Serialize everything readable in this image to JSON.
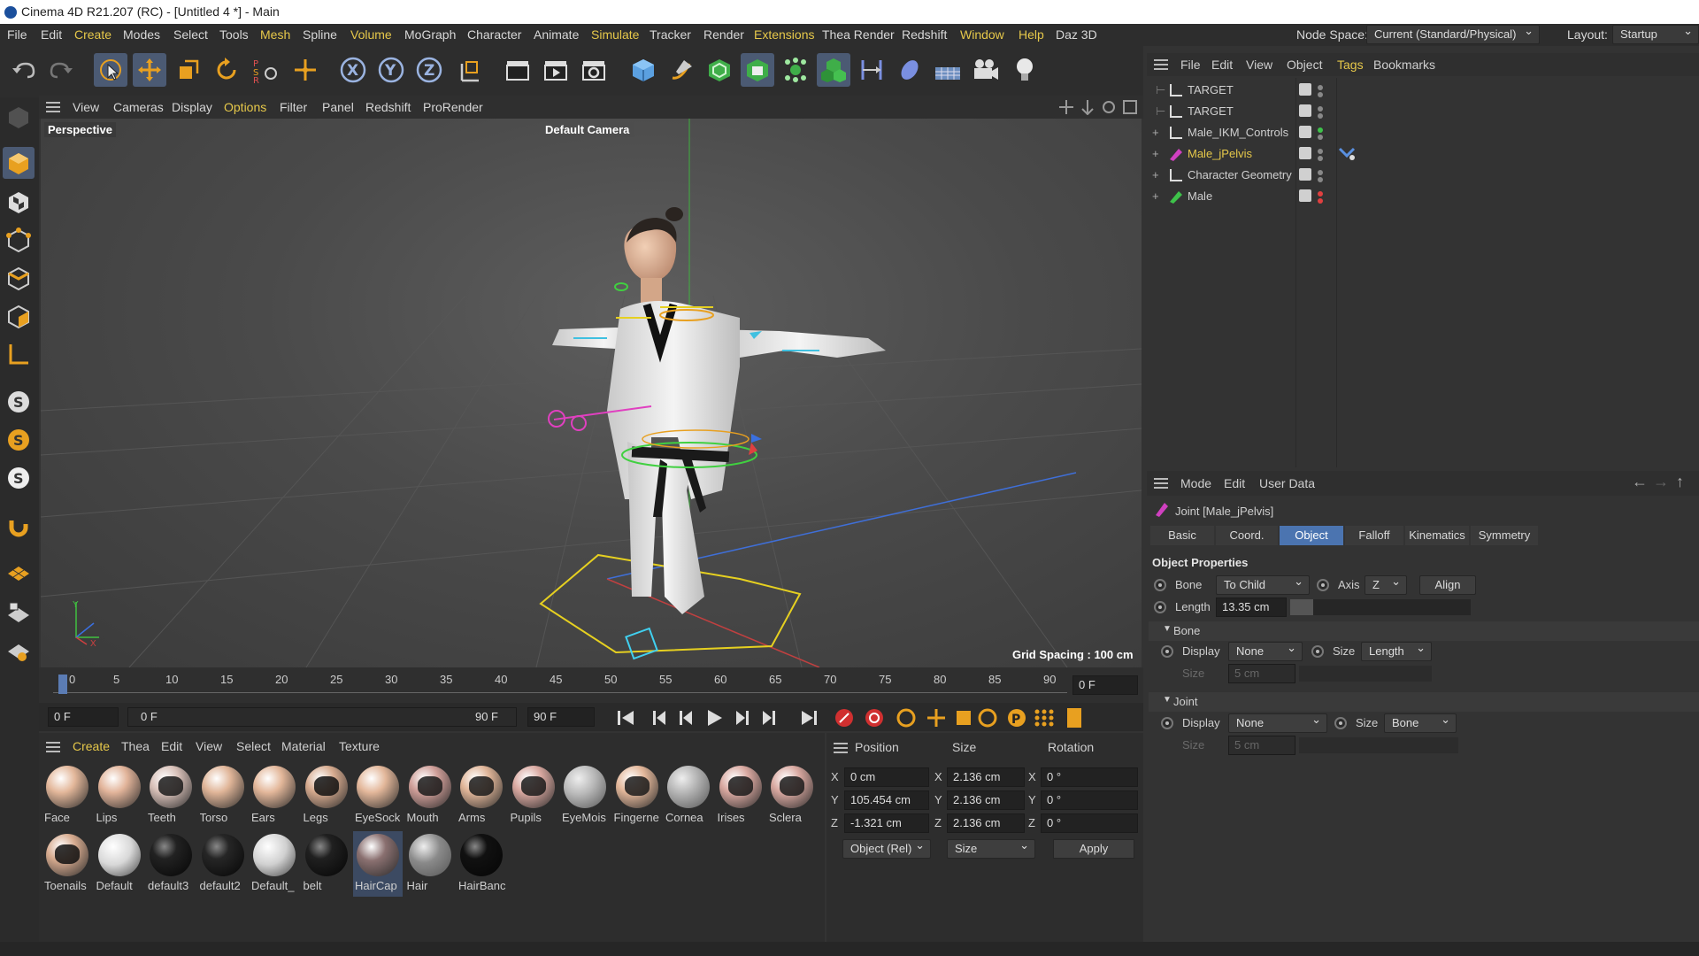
{
  "window": {
    "title": "Cinema 4D R21.207 (RC) - [Untitled 4 *] - Main"
  },
  "menubar": {
    "items": [
      "File",
      "Edit",
      "Create",
      "Modes",
      "Select",
      "Tools",
      "Mesh",
      "Spline",
      "Volume",
      "MoGraph",
      "Character",
      "Animate",
      "Simulate",
      "Tracker",
      "Render",
      "Extensions",
      "Thea Render",
      "Redshift",
      "Window",
      "Help",
      "Daz 3D"
    ],
    "node_space_label": "Node Space:",
    "node_space_value": "Current (Standard/Physical)",
    "layout_label": "Layout:",
    "layout_value": "Startup"
  },
  "viewport": {
    "menu": [
      "View",
      "Cameras",
      "Display",
      "Options",
      "Filter",
      "Panel",
      "Redshift",
      "ProRender"
    ],
    "label": "Perspective",
    "camera": "Default Camera",
    "grid_spacing": "Grid Spacing : 100 cm",
    "axis_y": "Y",
    "axis_x": "X"
  },
  "timeline": {
    "ticks": [
      "0",
      "5",
      "10",
      "15",
      "20",
      "25",
      "30",
      "35",
      "40",
      "45",
      "50",
      "55",
      "60",
      "65",
      "70",
      "75",
      "80",
      "85",
      "90"
    ],
    "current_frame": "0 F"
  },
  "transport": {
    "start": "0 F",
    "range_start": "0 F",
    "range_end": "90 F",
    "end": "90 F"
  },
  "material_panel": {
    "menu": [
      "Create",
      "Thea",
      "Edit",
      "View",
      "Select",
      "Material",
      "Texture"
    ],
    "materials": [
      {
        "name": "Face",
        "color": "#e3b79a",
        "style": "skin"
      },
      {
        "name": "Lips",
        "color": "#e2b49a",
        "style": "skin"
      },
      {
        "name": "Teeth",
        "color": "#d8c0b8",
        "style": "teeth"
      },
      {
        "name": "Torso",
        "color": "#e0b598",
        "style": "skin"
      },
      {
        "name": "Ears",
        "color": "#e3b79a",
        "style": "skin"
      },
      {
        "name": "Legs",
        "color": "#d7ab8f",
        "style": "legs"
      },
      {
        "name": "EyeSock",
        "color": "#e3b79a",
        "style": "skin"
      },
      {
        "name": "Mouth",
        "color": "#cf9e98",
        "style": "teeth"
      },
      {
        "name": "Arms",
        "color": "#e0b598",
        "style": "arms"
      },
      {
        "name": "Pupils",
        "color": "#d9a8a0",
        "style": "pupils"
      },
      {
        "name": "EyeMois",
        "color": "#b8b8b8",
        "style": "glass"
      },
      {
        "name": "Fingerne",
        "color": "#e3b79a",
        "style": "arms"
      },
      {
        "name": "Cornea",
        "color": "#b0b0b0",
        "style": "glass"
      },
      {
        "name": "Irises",
        "color": "#d9a8a0",
        "style": "pupils"
      },
      {
        "name": "Sclera",
        "color": "#d9a8a0",
        "style": "pupils"
      },
      {
        "name": "Toenails",
        "color": "#d7ab8f",
        "style": "legs"
      },
      {
        "name": "Default",
        "color": "#d8d8d8",
        "style": "white"
      },
      {
        "name": "default3",
        "color": "#222222",
        "style": "dark"
      },
      {
        "name": "default2",
        "color": "#262626",
        "style": "dark"
      },
      {
        "name": "Default_",
        "color": "#d0d0d0",
        "style": "white"
      },
      {
        "name": "belt",
        "color": "#202020",
        "style": "dark"
      },
      {
        "name": "HairCap",
        "color": "#8a7070",
        "style": "haircap"
      },
      {
        "name": "Hair",
        "color": "#8a8a8a",
        "style": "glass"
      },
      {
        "name": "HairBanc",
        "color": "#111111",
        "style": "black"
      }
    ],
    "selected": "HairCap"
  },
  "coord_panel": {
    "headers": [
      "Position",
      "Size",
      "Rotation"
    ],
    "rows": [
      {
        "axis": "X",
        "pos": "0 cm",
        "size": "2.136 cm",
        "rot": "0 °"
      },
      {
        "axis": "Y",
        "pos": "105.454 cm",
        "size": "2.136 cm",
        "rot": "0 °"
      },
      {
        "axis": "Z",
        "pos": "-1.321 cm",
        "size": "2.136 cm",
        "rot": "0 °"
      }
    ],
    "mode": "Object (Rel)",
    "size_mode": "Size",
    "apply": "Apply"
  },
  "object_manager": {
    "menu": [
      "File",
      "Edit",
      "View",
      "Object",
      "Tags",
      "Bookmarks"
    ],
    "objects": [
      {
        "name": "TARGET",
        "expand": "",
        "dot": "#888888"
      },
      {
        "name": "TARGET",
        "expand": "",
        "dot": "#888888"
      },
      {
        "name": "Male_IKM_Controls",
        "expand": "+",
        "dot": "#3ec24a"
      },
      {
        "name": "Male_jPelvis",
        "expand": "+",
        "dot": "#888888"
      },
      {
        "name": "Character Geometry",
        "expand": "+",
        "dot": "#888888"
      },
      {
        "name": "Male",
        "expand": "+",
        "dot": "#e04040"
      }
    ],
    "selected": "Male_jPelvis"
  },
  "attributes": {
    "menu": [
      "Mode",
      "Edit",
      "User Data"
    ],
    "title": "Joint [Male_jPelvis]",
    "tabs": [
      "Basic",
      "Coord.",
      "Object",
      "Falloff",
      "Kinematics",
      "Symmetry"
    ],
    "active_tab": "Object",
    "section": "Object Properties",
    "bone_label": "Bone",
    "bone_value": "To Child",
    "axis_label": "Axis",
    "axis_value": "Z",
    "align": "Align",
    "length_label": "Length",
    "length_value": "13.35 cm",
    "bone_group": "Bone",
    "bone_display_label": "Display",
    "bone_display_value": "None",
    "bone_size_label": "Size",
    "bone_size_value": "Length",
    "bone_size2_label": "Size",
    "bone_size2_value": "5 cm",
    "joint_group": "Joint",
    "joint_display_label": "Display",
    "joint_display_value": "None",
    "joint_size_label": "Size",
    "joint_size_value": "Bone",
    "joint_size2_label": "Size",
    "joint_size2_value": "5 cm"
  }
}
